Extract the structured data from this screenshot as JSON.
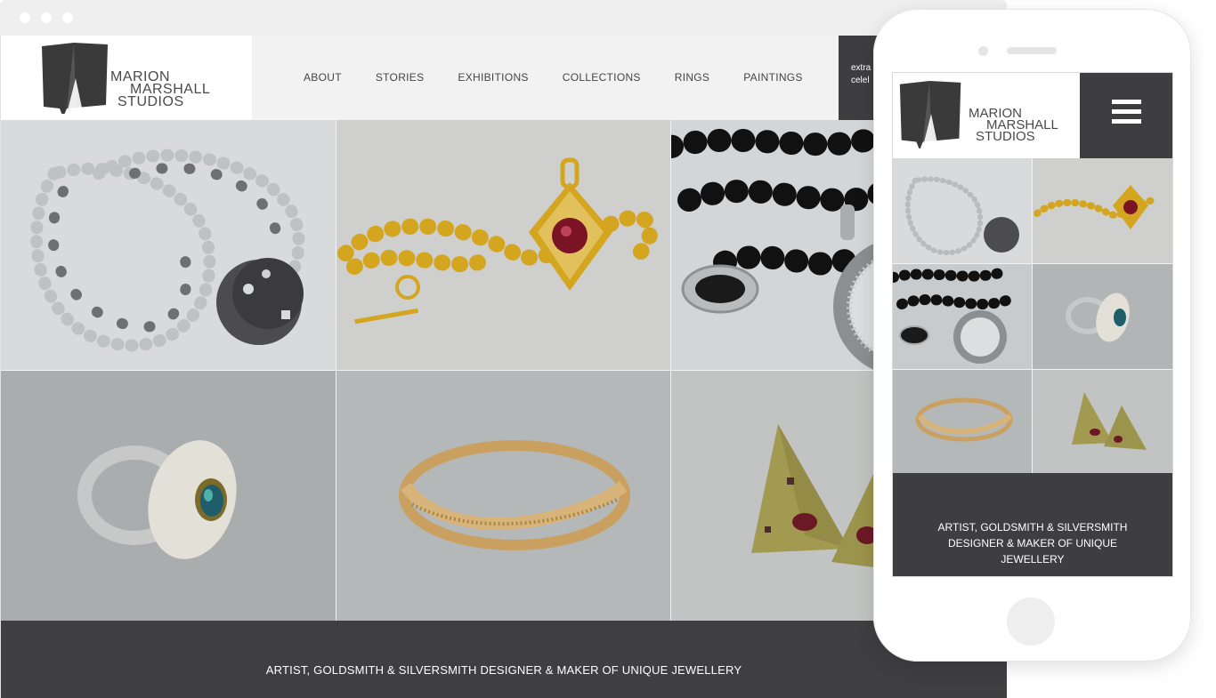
{
  "browser": {
    "window_dots": [
      "close",
      "minimize",
      "maximize"
    ]
  },
  "site": {
    "logo": {
      "lines": [
        "MARION",
        "MARSHALL",
        "STUDIOS"
      ],
      "icon": "folded-slate-logo-icon"
    },
    "nav": [
      "ABOUT",
      "STORIES",
      "EXHIBITIONS",
      "COLLECTIONS",
      "RINGS",
      "PAINTINGS"
    ],
    "header_tagline": "extra\ncelel",
    "gallery": [
      {
        "subject": "pearl necklace with dark clasp",
        "colors": [
          "#d8dadb",
          "#4c4c4e"
        ]
      },
      {
        "subject": "gold bead necklace with ruby pendant",
        "colors": [
          "#cfcfcd",
          "#d4a51e"
        ]
      },
      {
        "subject": "black onyx beads and pendant",
        "colors": [
          "#d3d6d8",
          "#111111"
        ]
      },
      {
        "subject": "silver ring with opal",
        "colors": [
          "#a9adae",
          "#e5e3dc"
        ]
      },
      {
        "subject": "gold twisted bangle",
        "colors": [
          "#b5b8b9",
          "#caa060"
        ]
      },
      {
        "subject": "triangular gold earrings with rubies",
        "colors": [
          "#c1c4c2",
          "#a39a52"
        ]
      }
    ],
    "footer_text": "ARTIST, GOLDSMITH & SILVERSMITH DESIGNER & MAKER OF UNIQUE JEWELLERY"
  },
  "mobile": {
    "logo": {
      "lines": [
        "MARION",
        "MARSHALL",
        "STUDIOS"
      ],
      "icon": "folded-slate-logo-icon"
    },
    "menu_icon": "hamburger-menu-icon",
    "footer_text": "ARTIST, GOLDSMITH & SILVERSMITH DESIGNER & MAKER OF UNIQUE JEWELLERY"
  },
  "colors": {
    "dark_panel": "#3e3e41",
    "header_bg": "#f2f2f2",
    "text": "#444444"
  }
}
